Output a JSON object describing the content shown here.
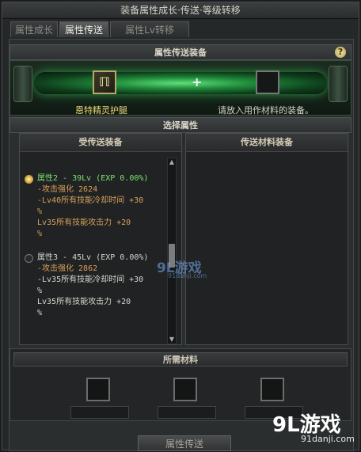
{
  "window": {
    "title": "装备属性成长·传送·等级转移"
  },
  "tabs": [
    {
      "label": "属性成长",
      "active": false
    },
    {
      "label": "属性传送",
      "active": true
    },
    {
      "label": "属性Lv转移",
      "active": false
    }
  ],
  "transfer": {
    "header": "属性传送装备",
    "help": "?",
    "source_item_name": "恩特精灵护腿",
    "target_placeholder": "请放入用作材料的装备。",
    "plus": "+"
  },
  "select": {
    "header": "选择属性",
    "left_title": "受传送装备",
    "right_title": "传送材料装备",
    "options": [
      {
        "title": "属性2 - 39Lv (EXP 0.00%)",
        "selected": true,
        "lines": [
          {
            "text": "-攻击强化 2624",
            "color": "orange"
          },
          {
            "text": "-Lv40所有技能冷却时间 +30",
            "color": "orange"
          },
          {
            "text": "%",
            "color": "orange"
          },
          {
            "text": "Lv35所有技能攻击力 +20",
            "color": "orange"
          },
          {
            "text": "%",
            "color": "orange"
          }
        ]
      },
      {
        "title": "属性3 - 45Lv (EXP 0.00%)",
        "selected": false,
        "lines": [
          {
            "text": "-攻击强化 2862",
            "color": "orange"
          },
          {
            "text": "-Lv35所有技能冷却时间 +30",
            "color": "white"
          },
          {
            "text": "%",
            "color": "white"
          },
          {
            "text": "Lv35所有技能攻击力 +20",
            "color": "white"
          },
          {
            "text": "%",
            "color": "white"
          }
        ]
      }
    ]
  },
  "materials": {
    "header": "所需材料"
  },
  "action": {
    "label": "属性传送"
  },
  "watermarks": {
    "logo_mid": "9L游戏",
    "site_mid": "91danji.com",
    "logo_corner": "9L游戏",
    "site_corner": "91danji.com"
  },
  "colors": {
    "selected_title": "#7ee06c",
    "stat_orange": "#d9a05a",
    "item_gold": "#f0d879"
  }
}
